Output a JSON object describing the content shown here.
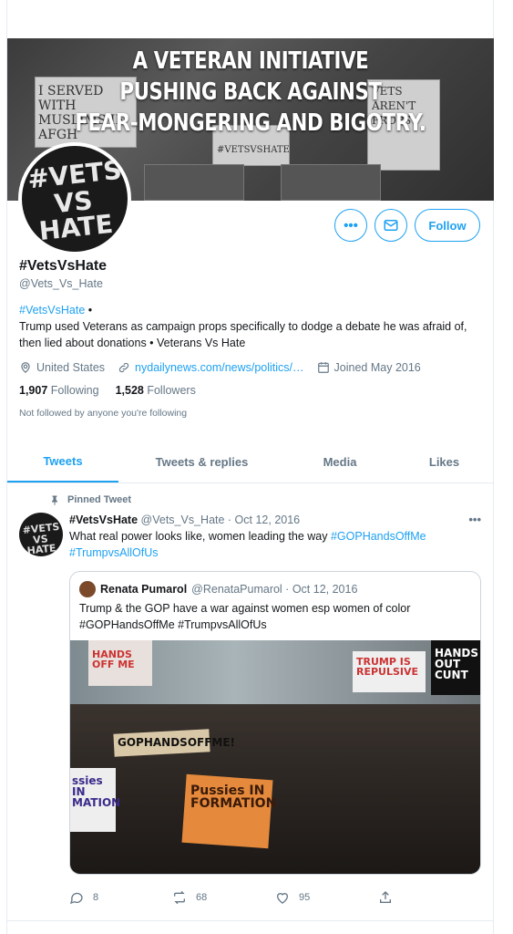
{
  "banner": {
    "line1": "A VETERAN INITIATIVE",
    "line2": "PUSHING BACK AGAINST",
    "line3": "FEAR-MONGERING AND BIGOTRY.",
    "sign_left": "I SERVED WITH MUSLIMS IN AFGH",
    "sign_right": "VETS AREN'T PROPS",
    "sign_mid": "#VETSVSHATE"
  },
  "avatar": {
    "line1": "#VETS",
    "line2": "VS HATE"
  },
  "profile": {
    "name": "#VetsVsHate",
    "handle": "@Vets_Vs_Hate",
    "bio_hashtag": "#VetsVsHate",
    "bio_bullet": " •",
    "bio_text": "Trump used Veterans as campaign props specifically to dodge a debate he was afraid of, then lied about donations • Veterans Vs Hate",
    "location": "United States",
    "website": "nydailynews.com/news/politics/…",
    "joined": "Joined May 2016",
    "following_count": "1,907",
    "following_label": "Following",
    "followers_count": "1,528",
    "followers_label": "Followers",
    "not_followed": "Not followed by anyone you're following",
    "follow_label": "Follow",
    "more_icon": "more-icon",
    "message_icon": "envelope-icon"
  },
  "tabs": [
    {
      "label": "Tweets",
      "active": true
    },
    {
      "label": "Tweets & replies"
    },
    {
      "label": "Media"
    },
    {
      "label": "Likes"
    }
  ],
  "tweet": {
    "pinned_label": "Pinned Tweet",
    "name": "#VetsVsHate",
    "meta": "@Vets_Vs_Hate · Oct 12, 2016",
    "text": "What real power looks like, women leading the way ",
    "hashtag1": "#GOPHandsOffMe",
    "hashtag2": "#TrumpvsAllOfUs",
    "more": "•••",
    "quote": {
      "name": "Renata Pumarol",
      "meta": "@RenataPumarol · Oct 12, 2016",
      "line1": "Trump & the GOP have a war against women esp women of color",
      "line2": "#GOPHandsOffMe #TrumpvsAllOfUs",
      "image_signs": [
        "GOPHANDSOFFME!",
        "Pussies IN FORMATION",
        "ssies IN MATION",
        "TRUMP IS REPULSIVE",
        "HANDS OUT CUNT",
        "HANDS OFF ME"
      ]
    },
    "reply_count": "8",
    "retweet_count": "68",
    "like_count": "95"
  }
}
